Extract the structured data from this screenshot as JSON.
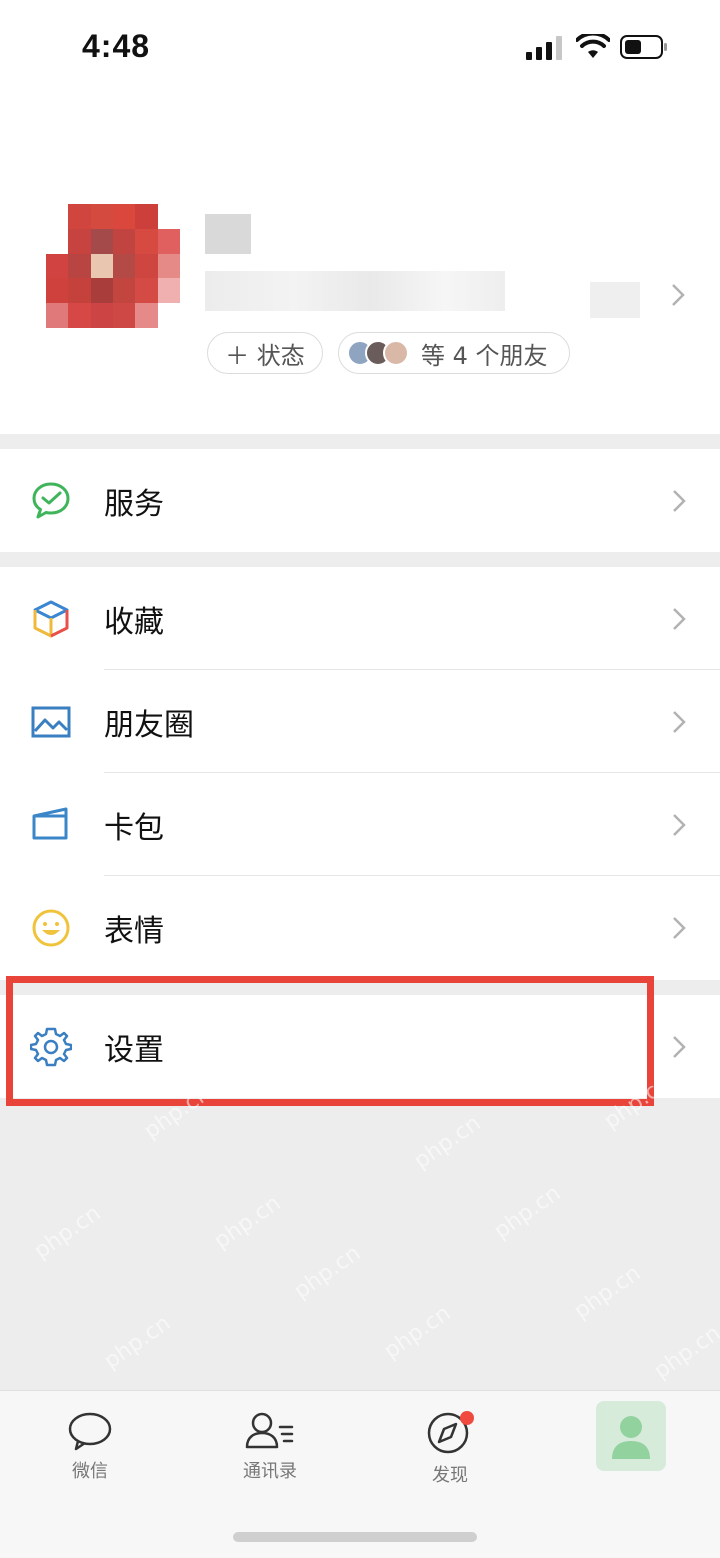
{
  "status_bar": {
    "time": "4:48"
  },
  "profile": {
    "status_button": "＋ 状态",
    "friends_text": "等 4 个朋友"
  },
  "menu": {
    "services": "服务",
    "favorites": "收藏",
    "moments": "朋友圈",
    "cards": "卡包",
    "stickers": "表情",
    "settings": "设置"
  },
  "tabbar": {
    "chats": "微信",
    "contacts": "通讯录",
    "discover": "发现"
  },
  "watermark_text": "php.cn",
  "colors": {
    "highlight": "#e8443a",
    "services_icon": "#3fb45a",
    "settings_icon": "#3a7fc1",
    "stickers_icon": "#f0c33c",
    "badge": "#f04a3f"
  }
}
